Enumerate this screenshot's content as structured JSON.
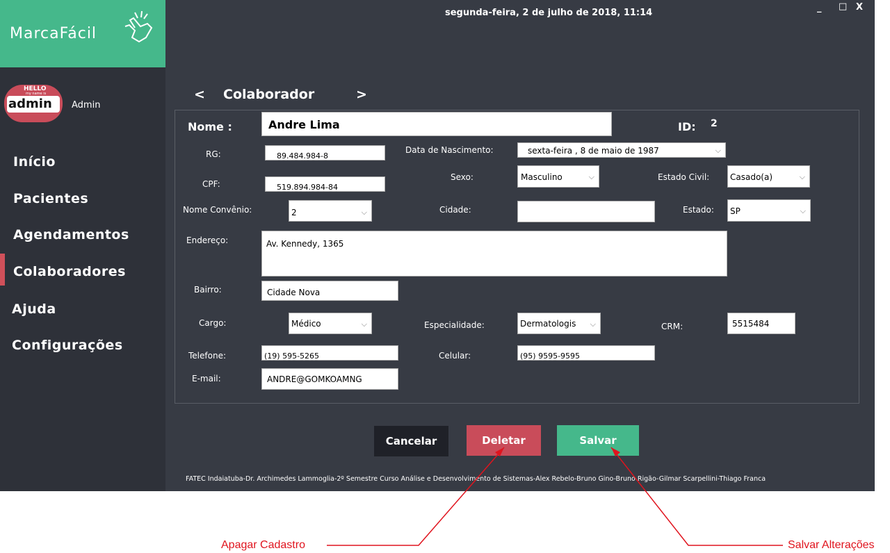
{
  "window": {
    "datetime": "segunda-feira, 2 de julho de 2018, 11:14",
    "minimize": "_",
    "maximize": "□",
    "close": "X"
  },
  "sidebar": {
    "logo": "MarcaFácil",
    "badge_top": "HELLO",
    "badge_small": "my name is",
    "badge_name": "admin",
    "user": "Admin",
    "items": [
      {
        "label": "Início"
      },
      {
        "label": "Pacientes"
      },
      {
        "label": "Agendamentos"
      },
      {
        "label": "Colaboradores"
      },
      {
        "label": "Ajuda"
      },
      {
        "label": "Configurações"
      }
    ],
    "active_index": 3
  },
  "header": {
    "prev": "<",
    "title": "Colaborador",
    "next": ">"
  },
  "form": {
    "nome_label": "Nome :",
    "nome_value": "Andre Lima",
    "id_label": "ID:",
    "id_value": "2",
    "rg_label": "RG:",
    "rg_value": "89.484.984-8",
    "nasc_label": "Data de Nascimento:",
    "nasc_value": "sexta-feira  ,  8 de     maio    de  1987",
    "cpf_label": "CPF:",
    "cpf_value": "519.894.984-84",
    "sexo_label": "Sexo:",
    "sexo_value": "Masculino",
    "civil_label": "Estado Civil:",
    "civil_value": "Casado(a)",
    "convenio_label": "Nome Convênio:",
    "convenio_value": "2",
    "cidade_label": "Cidade:",
    "cidade_value": "",
    "estado_label": "Estado:",
    "estado_value": "SP",
    "endereco_label": "Endereço:",
    "endereco_value": "Av. Kennedy, 1365",
    "bairro_label": "Bairro:",
    "bairro_value": "Cidade Nova",
    "cargo_label": "Cargo:",
    "cargo_value": "Médico",
    "especialidade_label": "Especialidade:",
    "especialidade_value": "Dermatologis",
    "crm_label": "CRM:",
    "crm_value": "5515484",
    "telefone_label": "Telefone:",
    "telefone_value": "(19)  595-5265",
    "celular_label": "Celular:",
    "celular_value": "(95)  9595-9595",
    "email_label": "E-mail:",
    "email_value": "ANDRE@GOMKOAMNG"
  },
  "actions": {
    "cancel": "Cancelar",
    "delete": "Deletar",
    "save": "Salvar"
  },
  "footer": "FATEC Indaiatuba-Dr. Archimedes Lammoglia-2º Semestre Curso Análise e Desenvolvimento de Sistemas-Alex Rebelo-Bruno Gino-Bruno Rigão-Gilmar Scarpellini-Thiago Franca",
  "annotations": {
    "delete_note": "Apagar Cadastro",
    "save_note": "Salvar Alterações"
  },
  "colors": {
    "accent_green": "#45b88b",
    "delete_red": "#c94c5a",
    "annotation_red": "#e0141e"
  }
}
